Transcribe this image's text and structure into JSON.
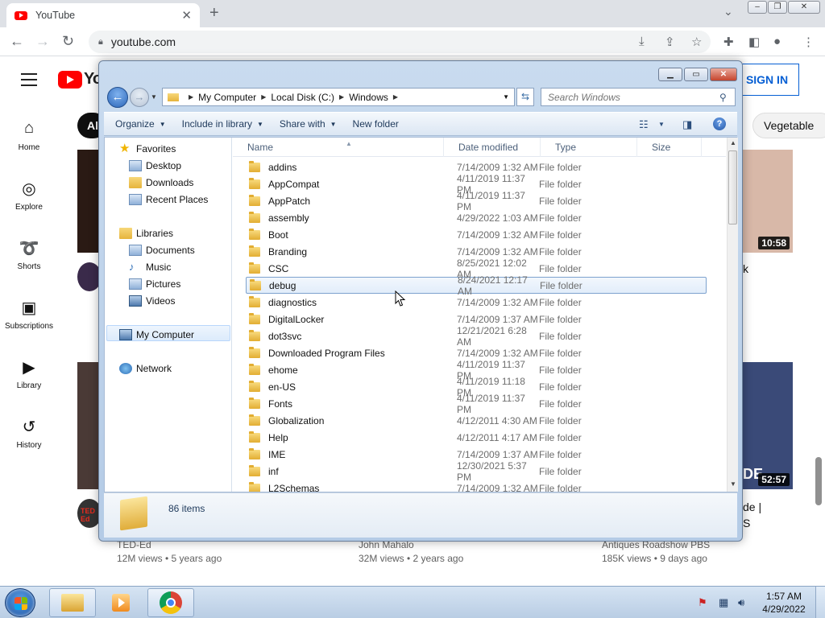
{
  "browser": {
    "tab_title": "YouTube",
    "tab_close": "✕",
    "new_tab": "+",
    "url": "youtube.com"
  },
  "youtube": {
    "logo_text": "Yo",
    "sign_in": "SIGN IN",
    "chip_all": "All",
    "chip_vegetables": "Vegetable",
    "sidebar": [
      {
        "label": "Home",
        "icon": "home-icon"
      },
      {
        "label": "Explore",
        "icon": "compass-icon"
      },
      {
        "label": "Shorts",
        "icon": "shorts-icon"
      },
      {
        "label": "Subscriptions",
        "icon": "subscriptions-icon"
      },
      {
        "label": "Library",
        "icon": "library-icon"
      },
      {
        "label": "History",
        "icon": "history-icon"
      }
    ],
    "durations": {
      "top_right": "10:58",
      "bottom_right": "52:57"
    },
    "fragments": {
      "title_a": "k",
      "title_b": "de |",
      "title_c": "S",
      "thumb_text": "DE"
    },
    "videos": [
      {
        "channel": "TED-Ed",
        "meta": "12M views • 5 years ago"
      },
      {
        "channel": "John Mahalo",
        "meta": "32M views • 2 years ago"
      },
      {
        "channel": "Antiques Roadshow PBS",
        "meta": "185K views • 9 days ago"
      }
    ],
    "ted_badge": "TED Ed"
  },
  "explorer": {
    "address": [
      "My Computer",
      "Local Disk (C:)",
      "Windows"
    ],
    "search_placeholder": "Search Windows",
    "commands": {
      "organize": "Organize",
      "include_in_library": "Include in library",
      "share_with": "Share with",
      "new_folder": "New folder"
    },
    "nav": {
      "favorites": "Favorites",
      "desktop": "Desktop",
      "downloads": "Downloads",
      "recent_places": "Recent Places",
      "libraries": "Libraries",
      "documents": "Documents",
      "music": "Music",
      "pictures": "Pictures",
      "videos": "Videos",
      "my_computer": "My Computer",
      "network": "Network"
    },
    "columns": {
      "name": "Name",
      "date": "Date modified",
      "type": "Type",
      "size": "Size"
    },
    "rows": [
      {
        "name": "addins",
        "date": "7/14/2009 1:32 AM",
        "type": "File folder"
      },
      {
        "name": "AppCompat",
        "date": "4/11/2019 11:37 PM",
        "type": "File folder"
      },
      {
        "name": "AppPatch",
        "date": "4/11/2019 11:37 PM",
        "type": "File folder"
      },
      {
        "name": "assembly",
        "date": "4/29/2022 1:03 AM",
        "type": "File folder"
      },
      {
        "name": "Boot",
        "date": "7/14/2009 1:32 AM",
        "type": "File folder"
      },
      {
        "name": "Branding",
        "date": "7/14/2009 1:32 AM",
        "type": "File folder"
      },
      {
        "name": "CSC",
        "date": "8/25/2021 12:02 AM",
        "type": "File folder"
      },
      {
        "name": "debug",
        "date": "8/24/2021 12:17 AM",
        "type": "File folder"
      },
      {
        "name": "diagnostics",
        "date": "7/14/2009 1:32 AM",
        "type": "File folder"
      },
      {
        "name": "DigitalLocker",
        "date": "7/14/2009 1:37 AM",
        "type": "File folder"
      },
      {
        "name": "dot3svc",
        "date": "12/21/2021 6:28 AM",
        "type": "File folder"
      },
      {
        "name": "Downloaded Program Files",
        "date": "7/14/2009 1:32 AM",
        "type": "File folder"
      },
      {
        "name": "ehome",
        "date": "4/11/2019 11:37 PM",
        "type": "File folder"
      },
      {
        "name": "en-US",
        "date": "4/11/2019 11:18 PM",
        "type": "File folder"
      },
      {
        "name": "Fonts",
        "date": "4/11/2019 11:37 PM",
        "type": "File folder"
      },
      {
        "name": "Globalization",
        "date": "4/12/2011 4:30 AM",
        "type": "File folder"
      },
      {
        "name": "Help",
        "date": "4/12/2011 4:17 AM",
        "type": "File folder"
      },
      {
        "name": "IME",
        "date": "7/14/2009 1:37 AM",
        "type": "File folder"
      },
      {
        "name": "inf",
        "date": "12/30/2021 5:37 PM",
        "type": "File folder"
      },
      {
        "name": "L2Schemas",
        "date": "7/14/2009 1:32 AM",
        "type": "File folder"
      }
    ],
    "selected_row": "debug",
    "item_count": "86 items"
  },
  "taskbar": {
    "time": "1:57 AM",
    "date": "4/29/2022"
  }
}
